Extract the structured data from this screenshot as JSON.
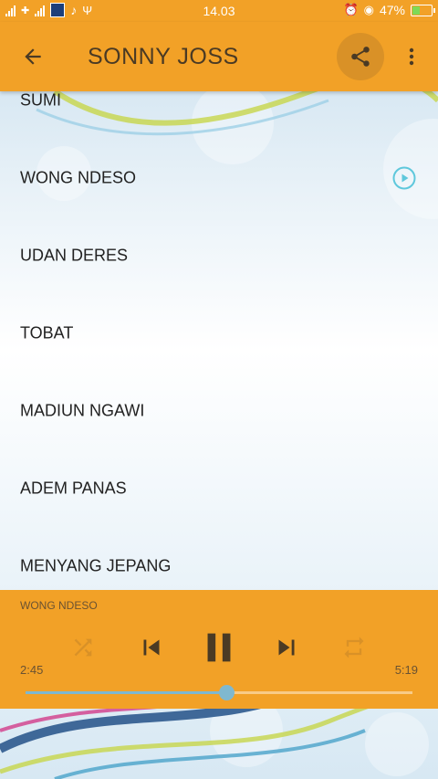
{
  "status_bar": {
    "time": "14.03",
    "battery": "47%",
    "battery_level": 0.47
  },
  "app_bar": {
    "title": "SONNY JOSS"
  },
  "songs": [
    {
      "title": "SUMI"
    },
    {
      "title": "WONG NDESO",
      "playing": true
    },
    {
      "title": "UDAN DERES"
    },
    {
      "title": "TOBAT"
    },
    {
      "title": "MADIUN NGAWI"
    },
    {
      "title": "ADEM PANAS"
    },
    {
      "title": "MENYANG JEPANG"
    }
  ],
  "player": {
    "now_playing": "WONG NDESO",
    "current_time": "2:45",
    "total_time": "5:19",
    "progress": 0.518
  },
  "colors": {
    "accent": "#f2a127",
    "accent_dark": "#d99127",
    "play_indicator": "#5fc8dc",
    "seek": "#7fb8cf"
  },
  "icons": [
    "back-arrow-icon",
    "share-icon",
    "more-vert-icon",
    "play-circle-icon",
    "shuffle-icon",
    "skip-previous-icon",
    "pause-icon",
    "skip-next-icon",
    "repeat-icon"
  ]
}
